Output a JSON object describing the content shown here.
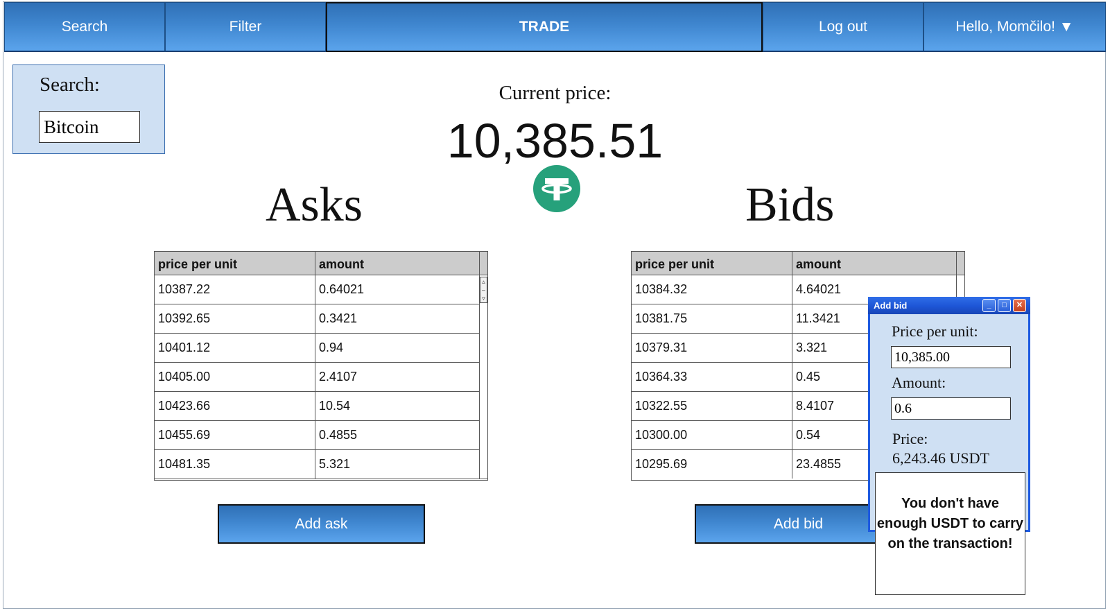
{
  "nav": {
    "items": [
      "Search",
      "Filter",
      "TRADE",
      "Log out",
      "Hello, Momčilo! ▼"
    ]
  },
  "search": {
    "label": "Search:",
    "value": "Bitcoin"
  },
  "price": {
    "label": "Current price:",
    "value": "10,385.51",
    "coin_icon": "tether-icon",
    "coin_color": "#26a17b"
  },
  "asks": {
    "title": "Asks",
    "columns": [
      "price per unit",
      "amount"
    ],
    "rows": [
      [
        "10387.22",
        "0.64021"
      ],
      [
        "10392.65",
        "0.3421"
      ],
      [
        "10401.12",
        "0.94"
      ],
      [
        "10405.00",
        "2.4107"
      ],
      [
        "10423.66",
        "10.54"
      ],
      [
        "10455.69",
        "0.4855"
      ],
      [
        "10481.35",
        "5.321"
      ]
    ],
    "button": "Add ask"
  },
  "bids": {
    "title": "Bids",
    "columns": [
      "price per unit",
      "amount"
    ],
    "rows": [
      [
        "10384.32",
        "4.64021"
      ],
      [
        "10381.75",
        "11.3421"
      ],
      [
        "10379.31",
        "3.321"
      ],
      [
        "10364.33",
        "0.45"
      ],
      [
        "10322.55",
        "8.4107"
      ],
      [
        "10300.00",
        "0.54"
      ],
      [
        "10295.69",
        "23.4855"
      ]
    ],
    "button": "Add bid"
  },
  "dialog": {
    "title": "Add bid",
    "price_label": "Price per unit:",
    "price_value": "10,385.00",
    "amount_label": "Amount:",
    "amount_value": "0.6",
    "total_label": "Price:",
    "total_value": "6,243.46 USDT"
  },
  "warning": {
    "text": "You don't have enough USDT to carry on the transaction!"
  },
  "colors": {
    "nav_gradient_top": "#2f70b6",
    "nav_gradient_bottom": "#5ba4ec",
    "panel_bg": "#cfe0f3",
    "dialog_border": "#1d5ae0"
  }
}
